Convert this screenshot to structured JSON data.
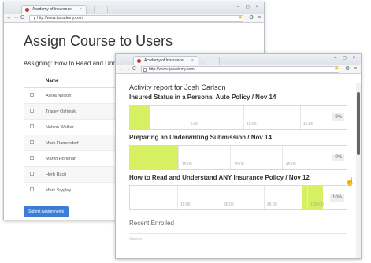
{
  "window1": {
    "tab_title": "Academy of Insurance",
    "url": "http://www.tjacademy.com/",
    "page_title": "Assign Course to Users",
    "subtitle": "Assigning: How to Read and Understand ANY Insurance Policy",
    "table": {
      "header": "Name",
      "rows": [
        "Alexa Nelson",
        "Tracey Oshinski",
        "Nelson Walker",
        "Mark Flamendorf",
        "Martin Horsman",
        "Herb Rach",
        "Mark Srygley"
      ]
    },
    "submit_label": "Submit Assignments"
  },
  "window2": {
    "tab_title": "Academy of Insurance",
    "url": "http://www.tjacademy.com/",
    "report_title": "Activity report for Josh Carlson",
    "sections": [
      {
        "title": "Insured Status in a Personal Auto Policy / Nov 14",
        "ticks": [
          "5:00",
          "10:00",
          "15:00"
        ],
        "percent": "9%",
        "progress": 9
      },
      {
        "title": "Preparing an Underwriting Submission / Nov 14",
        "ticks": [
          "15:00",
          "30:00",
          "45:00"
        ],
        "percent": "0%",
        "progress": 0
      },
      {
        "title": "How to Read and Understand ANY Insurance Policy / Nov 12",
        "ticks": [
          "15:00",
          "30:00",
          "45:00",
          "1:00:00"
        ],
        "percent": "10%",
        "progress": 10
      }
    ],
    "recent_title": "Recent Enrolled",
    "recent_first": "Course"
  },
  "colors": {
    "highlight": "#d7f062",
    "button": "#3b7dd8",
    "favicon": "#c4342d"
  }
}
